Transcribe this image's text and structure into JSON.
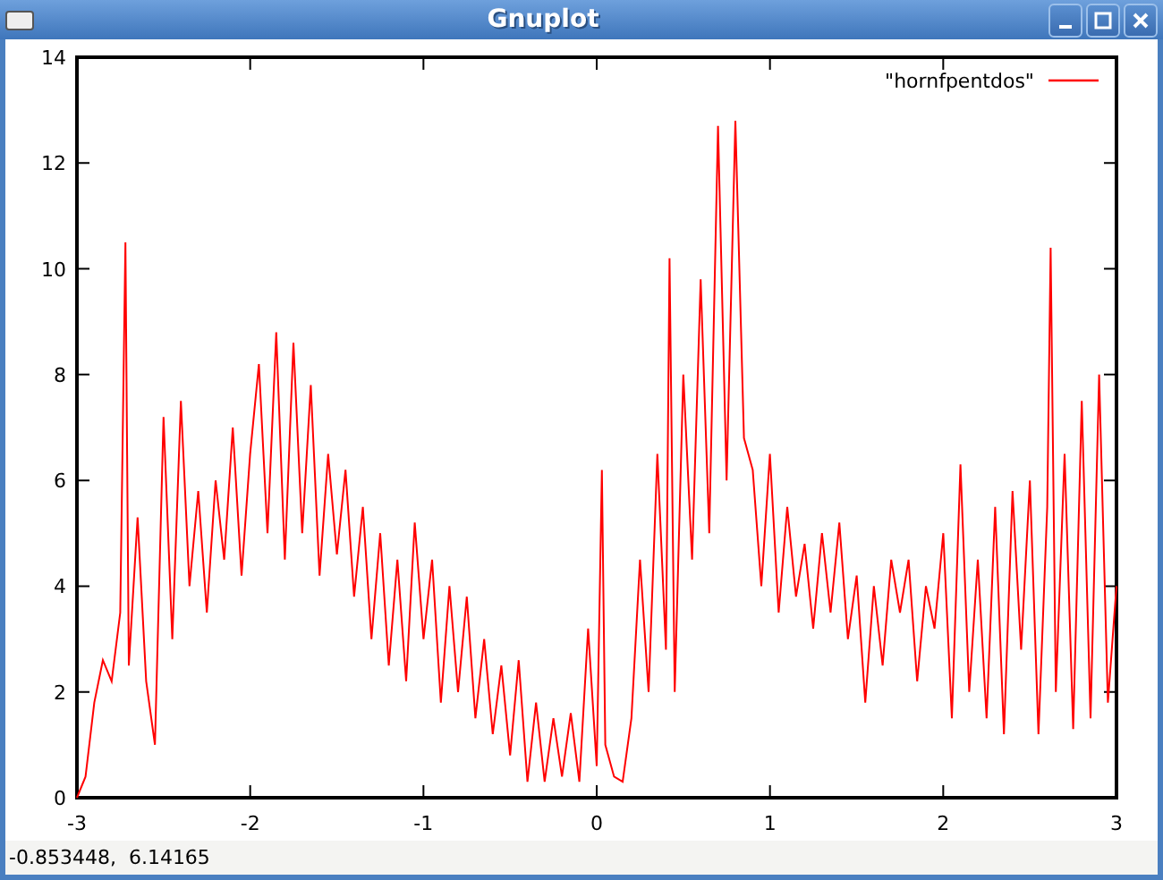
{
  "window": {
    "title": "Gnuplot"
  },
  "plot": {
    "chart_data": {
      "type": "line",
      "x": [
        -3,
        -2.95,
        -2.9,
        -2.85,
        -2.8,
        -2.75,
        -2.72,
        -2.7,
        -2.65,
        -2.6,
        -2.55,
        -2.5,
        -2.45,
        -2.4,
        -2.35,
        -2.3,
        -2.25,
        -2.2,
        -2.15,
        -2.1,
        -2.05,
        -2,
        -1.95,
        -1.9,
        -1.85,
        -1.8,
        -1.75,
        -1.7,
        -1.65,
        -1.6,
        -1.55,
        -1.5,
        -1.45,
        -1.4,
        -1.35,
        -1.3,
        -1.25,
        -1.2,
        -1.15,
        -1.1,
        -1.05,
        -1,
        -0.95,
        -0.9,
        -0.85,
        -0.8,
        -0.75,
        -0.7,
        -0.65,
        -0.6,
        -0.55,
        -0.5,
        -0.45,
        -0.4,
        -0.35,
        -0.3,
        -0.25,
        -0.2,
        -0.15,
        -0.1,
        -0.05,
        0,
        0.03,
        0.05,
        0.1,
        0.15,
        0.2,
        0.25,
        0.3,
        0.35,
        0.4,
        0.42,
        0.45,
        0.5,
        0.55,
        0.6,
        0.65,
        0.7,
        0.75,
        0.8,
        0.85,
        0.9,
        0.95,
        1,
        1.05,
        1.1,
        1.15,
        1.2,
        1.25,
        1.3,
        1.35,
        1.4,
        1.45,
        1.5,
        1.55,
        1.6,
        1.65,
        1.7,
        1.75,
        1.8,
        1.85,
        1.9,
        1.95,
        2,
        2.05,
        2.1,
        2.15,
        2.2,
        2.25,
        2.3,
        2.35,
        2.4,
        2.45,
        2.5,
        2.55,
        2.6,
        2.62,
        2.65,
        2.7,
        2.75,
        2.8,
        2.85,
        2.9,
        2.95,
        3
      ],
      "series": [
        {
          "name": "\"hornfpentdos\"",
          "color": "#ff0000",
          "values": [
            0,
            0.4,
            1.8,
            2.6,
            2.2,
            3.5,
            10.5,
            2.5,
            5.3,
            2.2,
            1,
            7.2,
            3,
            7.5,
            4,
            5.8,
            3.5,
            6,
            4.5,
            7,
            4.2,
            6.5,
            8.2,
            5,
            8.8,
            4.5,
            8.6,
            5,
            7.8,
            4.2,
            6.5,
            4.6,
            6.2,
            3.8,
            5.5,
            3,
            5,
            2.5,
            4.5,
            2.2,
            5.2,
            3,
            4.5,
            1.8,
            4,
            2,
            3.8,
            1.5,
            3,
            1.2,
            2.5,
            0.8,
            2.6,
            0.3,
            1.8,
            0.3,
            1.5,
            0.4,
            1.6,
            0.3,
            3.2,
            0.6,
            6.2,
            1,
            0.4,
            0.3,
            1.5,
            4.5,
            2,
            6.5,
            2.8,
            10.2,
            2,
            8,
            4.5,
            9.8,
            5,
            12.7,
            6,
            12.8,
            6.8,
            6.2,
            4,
            6.5,
            3.5,
            5.5,
            3.8,
            4.8,
            3.2,
            5,
            3.5,
            5.2,
            3,
            4.2,
            1.8,
            4,
            2.5,
            4.5,
            3.5,
            4.5,
            2.2,
            4,
            3.2,
            5,
            1.5,
            6.3,
            2,
            4.5,
            1.5,
            5.5,
            1.2,
            5.8,
            2.8,
            6,
            1.2,
            5.5,
            10.4,
            2,
            6.5,
            1.3,
            7.5,
            1.5,
            8,
            1.8,
            4
          ]
        }
      ],
      "xlim": [
        -3,
        3
      ],
      "ylim": [
        0,
        14
      ],
      "xticks": [
        -3,
        -2,
        -1,
        0,
        1,
        2,
        3
      ],
      "yticks": [
        0,
        2,
        4,
        6,
        8,
        10,
        12,
        14
      ]
    }
  },
  "status_bar": {
    "text": "-0.853448,  6.14165"
  }
}
